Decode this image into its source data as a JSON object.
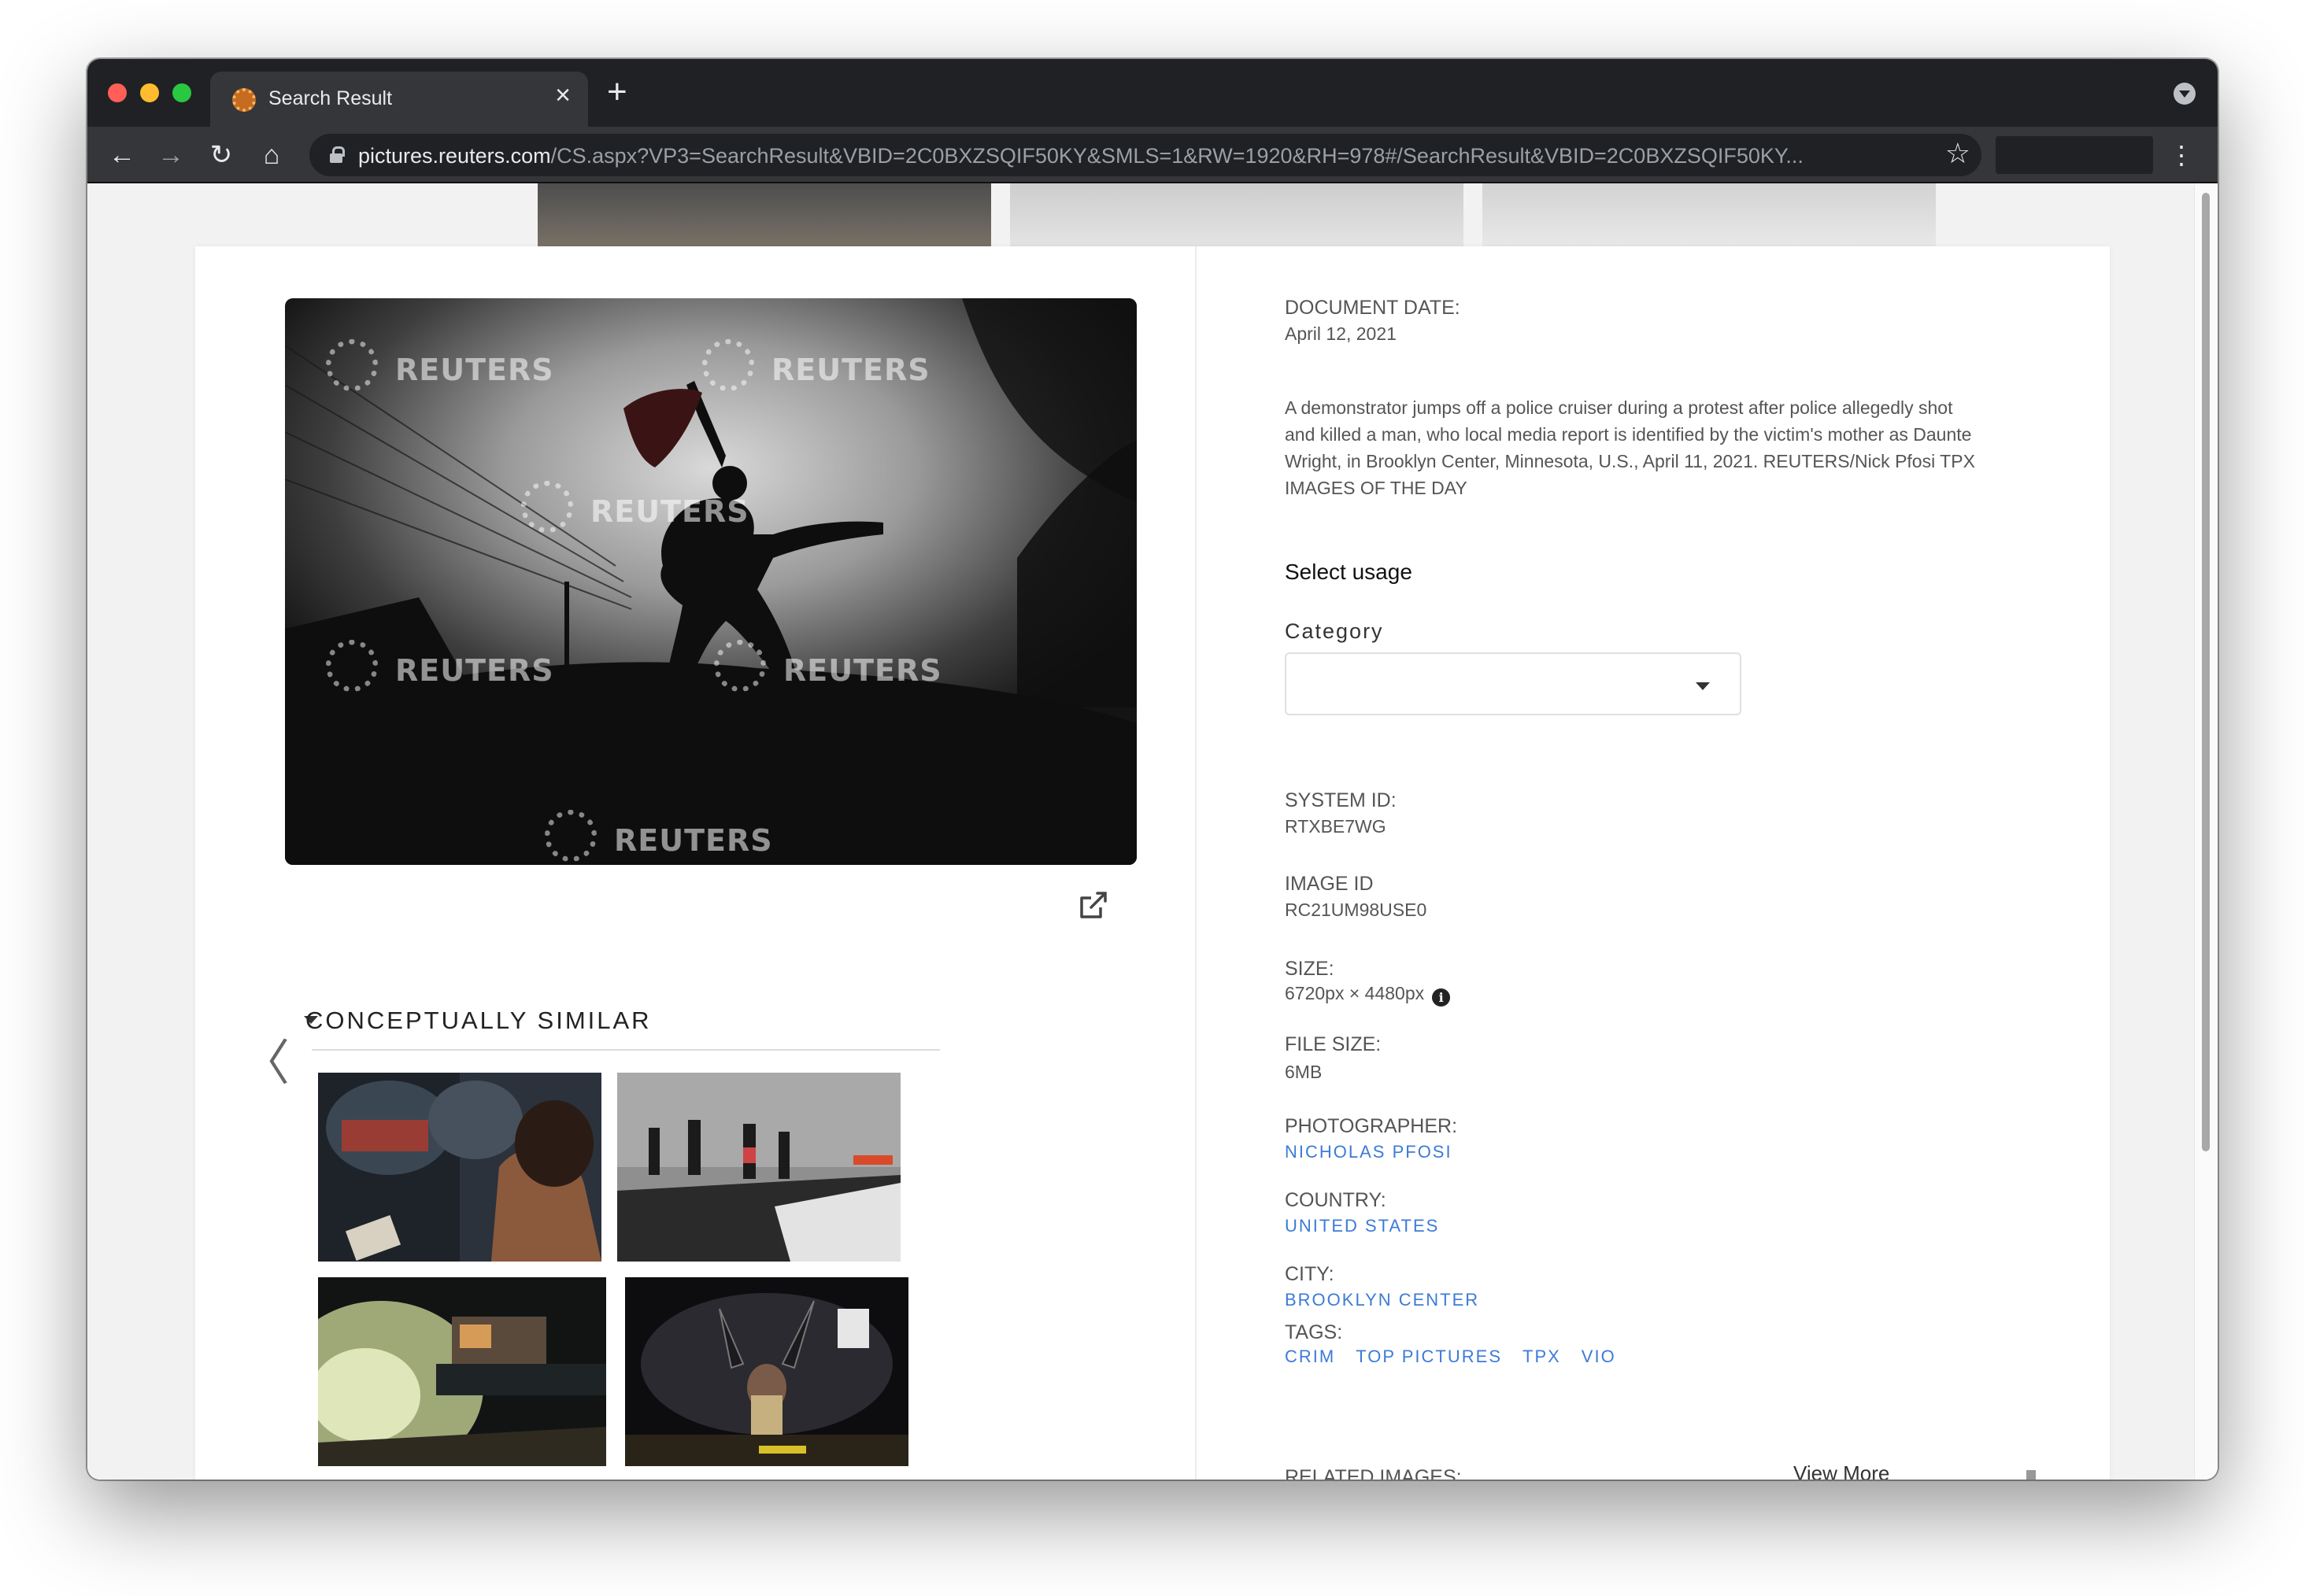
{
  "browser": {
    "tab_title": "Search Result",
    "url_host": "pictures.reuters.com",
    "url_path": "/CS.aspx?VP3=SearchResult&VBID=2C0BXZSQIF50KY&SMLS=1&RW=1920&RH=978#/SearchResult&VBID=2C0BXZSQIF50KY...",
    "icons": [
      "back-icon",
      "forward-icon",
      "reload-icon",
      "home-icon",
      "lock-icon",
      "star-icon",
      "menu-icon",
      "new-tab-icon",
      "close-icon"
    ]
  },
  "photo": {
    "watermark": "REUTERS"
  },
  "similar": {
    "title": "CONCEPTUALLY SIMILAR"
  },
  "details": {
    "document_date_label": "DOCUMENT DATE:",
    "document_date": "April 12, 2021",
    "caption": "A demonstrator jumps off a police cruiser during a protest after police allegedly shot and killed a man, who local media report is identified by the victim's mother as Daunte Wright, in Brooklyn Center, Minnesota, U.S., April 11, 2021. REUTERS/Nick Pfosi TPX IMAGES OF THE DAY",
    "select_usage": "Select usage",
    "category_label": "Category",
    "category_value": "",
    "system_id_label": "SYSTEM ID:",
    "system_id": "RTXBE7WG",
    "image_id_label": "IMAGE ID",
    "image_id": "RC21UM98USE0",
    "size_label": "SIZE:",
    "size": "6720px × 4480px",
    "file_size_label": "FILE SIZE:",
    "file_size": "6MB",
    "photographer_label": "PHOTOGRAPHER:",
    "photographer": "NICHOLAS PFOSI",
    "country_label": "COUNTRY:",
    "country": "UNITED STATES",
    "city_label": "CITY:",
    "city": "BROOKLYN CENTER",
    "tags_label": "TAGS:",
    "tags": [
      "CRIM",
      "TOP PICTURES",
      "TPX",
      "VIO"
    ],
    "related_label": "RELATED IMAGES:",
    "view_more": "View More"
  }
}
